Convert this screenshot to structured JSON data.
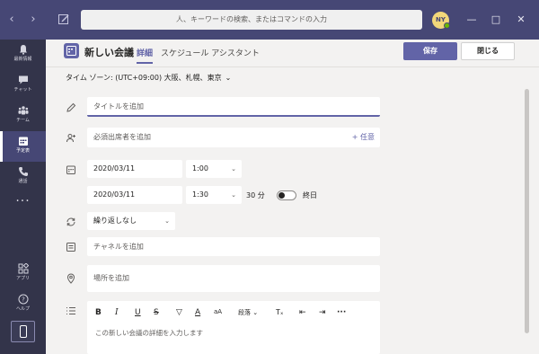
{
  "search": {
    "placeholder": "人、キーワードの検索、またはコマンドの入力"
  },
  "user": {
    "initials": "NY"
  },
  "rail": [
    {
      "label": "最新情報",
      "icon": "bell-icon"
    },
    {
      "label": "チャット",
      "icon": "chat-icon"
    },
    {
      "label": "チーム",
      "icon": "teams-icon"
    },
    {
      "label": "予定表",
      "icon": "calendar-icon"
    },
    {
      "label": "通話",
      "icon": "phone-icon"
    }
  ],
  "rail_bottom": [
    {
      "label": "アプリ",
      "icon": "apps-icon"
    },
    {
      "label": "ヘルプ",
      "icon": "help-icon"
    }
  ],
  "header": {
    "title": "新しい会議",
    "tabs": [
      "詳細",
      "スケジュール アシスタント"
    ],
    "save": "保存",
    "close": "閉じる"
  },
  "timezone": "タイム ゾーン: (UTC+09:00) 大阪、札幌、東京",
  "form": {
    "title_placeholder": "タイトルを追加",
    "attendees_placeholder": "必須出席者を追加",
    "optional_link": "+ 任意",
    "start_date": "2020/03/11",
    "start_time": "1:00",
    "end_date": "2020/03/11",
    "end_time": "1:30",
    "duration": "30 分",
    "all_day": "終日",
    "repeat": "繰り返しなし",
    "channel_placeholder": "チャネルを追加",
    "location_placeholder": "場所を追加",
    "toolbar_paragraph": "段落",
    "details_placeholder": "この新しい会議の詳細を入力します"
  },
  "colors": {
    "accent": "#6264a7",
    "titlebar": "#464775",
    "rail": "#33344a"
  }
}
